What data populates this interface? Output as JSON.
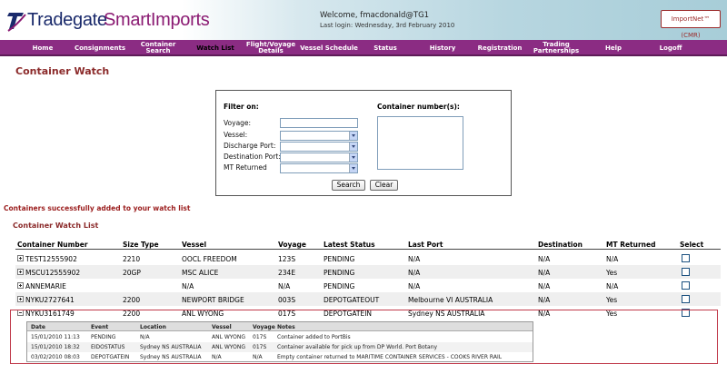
{
  "header": {
    "logo_part1": "Tradegate",
    "logo_part2": "SmartImports",
    "welcome": "Welcome, fmacdonald@TG1",
    "last_login": "Last login: Wednesday, 3rd February 2010",
    "importnet_label": "ImportNet™ (CMR)"
  },
  "nav": {
    "items": [
      {
        "label": "Home"
      },
      {
        "label": "Consignments"
      },
      {
        "label": "Container Search"
      },
      {
        "label": "Watch List"
      },
      {
        "label": "Flight/Voyage Details"
      },
      {
        "label": "Vessel Schedule"
      },
      {
        "label": "Status"
      },
      {
        "label": "History"
      },
      {
        "label": "Registration"
      },
      {
        "label": "Trading Partnerships"
      },
      {
        "label": "Help"
      },
      {
        "label": "Logoff"
      }
    ],
    "active": "Watch List"
  },
  "page_title": "Container Watch",
  "filter": {
    "title": "Filter on:",
    "container_numbers_label": "Container number(s):",
    "voyage_label": "Voyage:",
    "vessel_label": "Vessel:",
    "discharge_port_label": "Discharge Port:",
    "destination_port_label": "Destination Port:",
    "mt_returned_label": "MT Returned",
    "search_button": "Search",
    "clear_button": "Clear"
  },
  "success_message": "Containers successfully added to your watch list",
  "watch_list": {
    "title": "Container Watch List",
    "columns": [
      "Container Number",
      "Size Type",
      "Vessel",
      "Voyage",
      "Latest Status",
      "Last Port",
      "Destination",
      "MT Returned",
      "Select"
    ],
    "rows": [
      {
        "container": "TEST12555902",
        "size_type": "2210",
        "vessel": "OOCL FREEDOM",
        "voyage": "123S",
        "status": "PENDING",
        "last_port": "N/A",
        "destination": "N/A",
        "mt_returned": "N/A",
        "expanded": false
      },
      {
        "container": "MSCU12555902",
        "size_type": "20GP",
        "vessel": "MSC ALICE",
        "voyage": "234E",
        "status": "PENDING",
        "last_port": "N/A",
        "destination": "N/A",
        "mt_returned": "Yes",
        "expanded": false
      },
      {
        "container": "ANNEMARIE",
        "size_type": "",
        "vessel": "N/A",
        "voyage": "N/A",
        "status": "PENDING",
        "last_port": "N/A",
        "destination": "N/A",
        "mt_returned": "N/A",
        "expanded": false
      },
      {
        "container": "NYKU2727641",
        "size_type": "2200",
        "vessel": "NEWPORT BRIDGE",
        "voyage": "003S",
        "status": "DEPOTGATEOUT",
        "last_port": "Melbourne VI AUSTRALIA",
        "destination": "N/A",
        "mt_returned": "Yes",
        "expanded": false
      },
      {
        "container": "NYKU3161749",
        "size_type": "2200",
        "vessel": "ANL WYONG",
        "voyage": "017S",
        "status": "DEPOTGATEIN",
        "last_port": "Sydney NS AUSTRALIA",
        "destination": "N/A",
        "mt_returned": "Yes",
        "expanded": true
      }
    ]
  },
  "history": {
    "columns": [
      "Date",
      "Event",
      "Location",
      "Vessel",
      "Voyage",
      "Notes"
    ],
    "rows": [
      {
        "date": "15/01/2010 11:13",
        "event": "PENDING",
        "location": "N/A",
        "vessel": "ANL WYONG",
        "voyage": "017S",
        "notes": "Container added to PortBis"
      },
      {
        "date": "15/01/2010 18:32",
        "event": "EIDOSTATUS",
        "location": "Sydney NS AUSTRALIA",
        "vessel": "ANL WYONG",
        "voyage": "017S",
        "notes": "Container available for pick up from DP World. Port Botany"
      },
      {
        "date": "03/02/2010 08:03",
        "event": "DEPOTGATEIN",
        "location": "Sydney NS AUSTRALIA",
        "vessel": "N/A",
        "voyage": "N/A",
        "notes": "Empty container returned to MARITIME CONTAINER SERVICES - COOKS RIVER RAIL"
      }
    ]
  },
  "colors": {
    "nav_bg": "#8b2c83",
    "title_red": "#8b2a2a",
    "highlight_border": "#c0394a",
    "logo_blue": "#1a2a6b",
    "logo_purple": "#8a1a72"
  }
}
